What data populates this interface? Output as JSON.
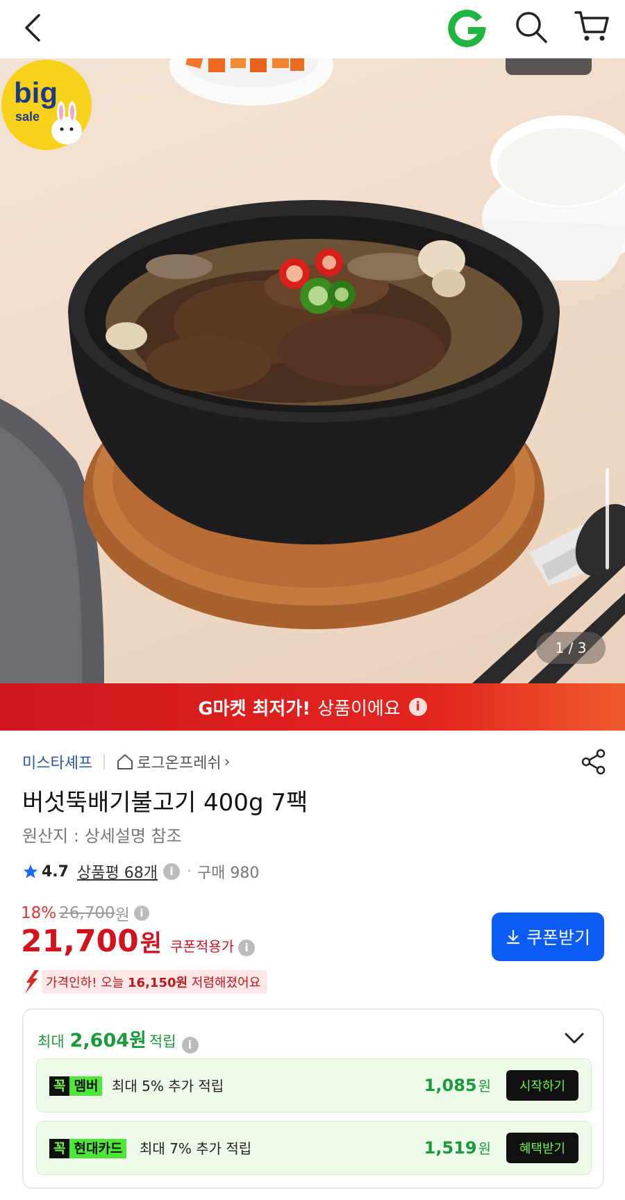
{
  "colors": {
    "brand_green": "#1fb540",
    "price_red": "#d2121c",
    "coupon_blue": "#0a5cf5",
    "banner_red": "#e3261f",
    "points_green": "#1a9a3a"
  },
  "topbar": {
    "back_icon": "chevron-left-icon",
    "logo_icon": "gmarket-g-logo",
    "search_icon": "search-icon",
    "cart_icon": "cart-icon"
  },
  "hero": {
    "page_counter": "1 / 3",
    "badge_line1": "big",
    "badge_line2": "sale"
  },
  "banner": {
    "strong": "G마켓 최저가!",
    "normal": "상품이에요",
    "info_glyph": "i"
  },
  "product": {
    "seller": "미스타셰프",
    "store": "로그온프레쉬",
    "store_chevron": "›",
    "title": "버섯뚝배기불고기 400g 7팩",
    "origin": "원산지 : 상세설명 참조",
    "rating": "4.7",
    "reviews": "상품평 68개",
    "dot": "·",
    "purchases": "구매 980",
    "discount_rate": "18%",
    "original_price": "26,700",
    "original_unit": "원",
    "price": "21,700",
    "price_unit": "원",
    "price_label": "쿠폰적용가",
    "info_glyph": "i",
    "coupon_button": "쿠폰받기",
    "cut_prefix": "가격인하! 오늘 ",
    "cut_amount": "16,150원",
    "cut_suffix": " 저렴해졌어요"
  },
  "points": {
    "prefix": "최대",
    "amount": "2,604원",
    "suffix": "적립",
    "info_glyph": "i",
    "benefits": [
      {
        "tag_k": "꼭",
        "tag_name": "멤버",
        "desc": "최대 5% 추가 적립",
        "points": "1,085",
        "unit": "원",
        "action": "시작하기"
      },
      {
        "tag_k": "꼭",
        "tag_name": "현대카드",
        "desc": "최대 7% 추가 적립",
        "points": "1,519",
        "unit": "원",
        "action": "혜택받기"
      }
    ]
  }
}
